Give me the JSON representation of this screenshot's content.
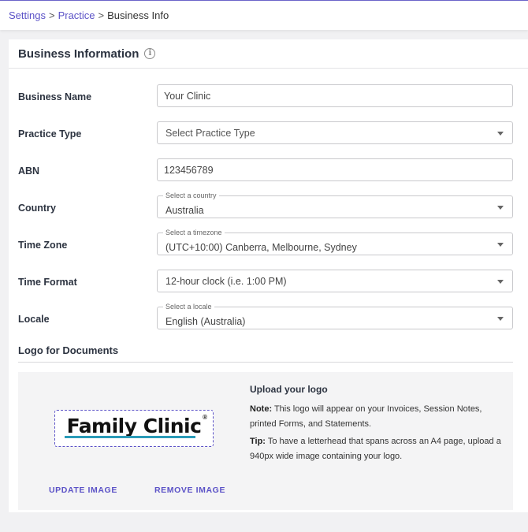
{
  "breadcrumb": {
    "settings": "Settings",
    "practice": "Practice",
    "current": "Business Info",
    "sep": ">"
  },
  "card": {
    "title": "Business Information"
  },
  "fields": {
    "business_name": {
      "label": "Business Name",
      "value": "Your Clinic"
    },
    "practice_type": {
      "label": "Practice Type",
      "value": "Select Practice Type"
    },
    "abn": {
      "label": "ABN",
      "value": "123456789"
    },
    "country": {
      "label": "Country",
      "float": "Select a country",
      "value": "Australia"
    },
    "time_zone": {
      "label": "Time Zone",
      "float": "Select a timezone",
      "value": "(UTC+10:00) Canberra, Melbourne, Sydney"
    },
    "time_format": {
      "label": "Time Format",
      "value": "12-hour clock (i.e. 1:00 PM)"
    },
    "locale": {
      "label": "Locale",
      "float": "Select a locale",
      "value": "English (Australia)"
    }
  },
  "logo_section": {
    "title": "Logo for Documents",
    "logo_text": "Family Clinic",
    "update_label": "UPDATE IMAGE",
    "remove_label": "REMOVE IMAGE",
    "upload_title": "Upload your logo",
    "note_label": "Note:",
    "note_text": " This logo will appear on your Invoices, Session Notes, printed Forms, and Statements.",
    "tip_label": "Tip:",
    "tip_text": " To have a letterhead that spans across an A4 page, upload a 940px wide image containing your logo."
  },
  "colors": {
    "accent": "#5b52c7",
    "logo_underline": "#2a9bb8"
  }
}
